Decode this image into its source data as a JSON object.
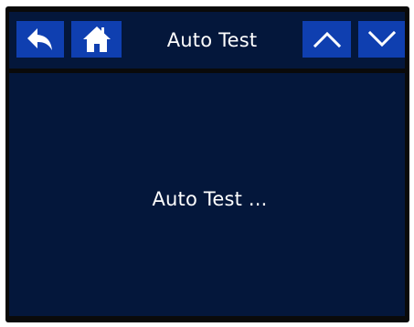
{
  "header": {
    "title": "Auto Test",
    "buttons": {
      "back": {
        "icon": "back-arrow-icon"
      },
      "home": {
        "icon": "home-icon"
      },
      "up": {
        "icon": "chevron-up-icon"
      },
      "down": {
        "icon": "chevron-down-icon"
      }
    }
  },
  "main": {
    "message": "Auto Test ..."
  },
  "colors": {
    "background": "#04173b",
    "button": "#0f3fb0",
    "text": "#ffffff",
    "frame": "#0a0a0a"
  }
}
